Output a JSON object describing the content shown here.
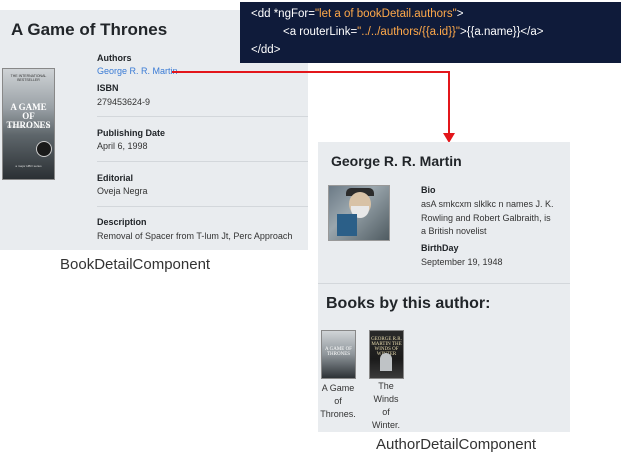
{
  "book": {
    "title": "A Game of Thrones",
    "cover": {
      "top_text": "THE INTERNATIONAL BESTSELLER",
      "title_text": "A GAME OF THRONES",
      "author_text": "GEORGE R.R. MARTIN",
      "footer_text": "a major HBO series"
    },
    "authors_label": "Authors",
    "author_link": "George R. R. Martin",
    "isbn_label": "ISBN",
    "isbn": "279453624-9",
    "pubdate_label": "Publishing Date",
    "pubdate": "April 6, 1998",
    "editorial_label": "Editorial",
    "editorial": "Oveja Negra",
    "description_label": "Description",
    "description": "Removal of Spacer from T-lum Jt, Perc Approach"
  },
  "book_caption": "BookDetailComponent",
  "code": {
    "line1_open": "<dd *ngFor=",
    "line1_value": "\"let a of bookDetail.authors\"",
    "line1_close": ">",
    "line2_open": "<a routerLink=",
    "line2_value": "\"../../authors/{{a.id}}\"",
    "line2_close": ">{{a.name}}</a>",
    "line3": "</dd>"
  },
  "author": {
    "name": "George R. R. Martin",
    "bio_label": "Bio",
    "bio_line1": "asA smkcxm slklkc n names J. K.",
    "bio_line2": "Rowling and Robert Galbraith, is",
    "bio_line3": "a British novelist",
    "birthday_label": "BirthDay",
    "birthday": "September 19, 1948",
    "books_heading": "Books by this author:",
    "books": [
      {
        "cover_text": "A GAME OF THRONES",
        "caption_lines": [
          "A Game",
          "of",
          "Thrones."
        ]
      },
      {
        "cover_text": "GEORGE R.R. MARTIN THE WINDS OF WINTER",
        "caption_lines": [
          "The",
          "Winds",
          "of",
          "Winter."
        ]
      }
    ]
  },
  "author_caption": "AuthorDetailComponent",
  "colors": {
    "panel_bg": "#e9ecef",
    "link": "#3a7bd5",
    "code_bg": "#0f1b3a",
    "code_string": "#ffa94a",
    "arrow": "#e3161b"
  }
}
